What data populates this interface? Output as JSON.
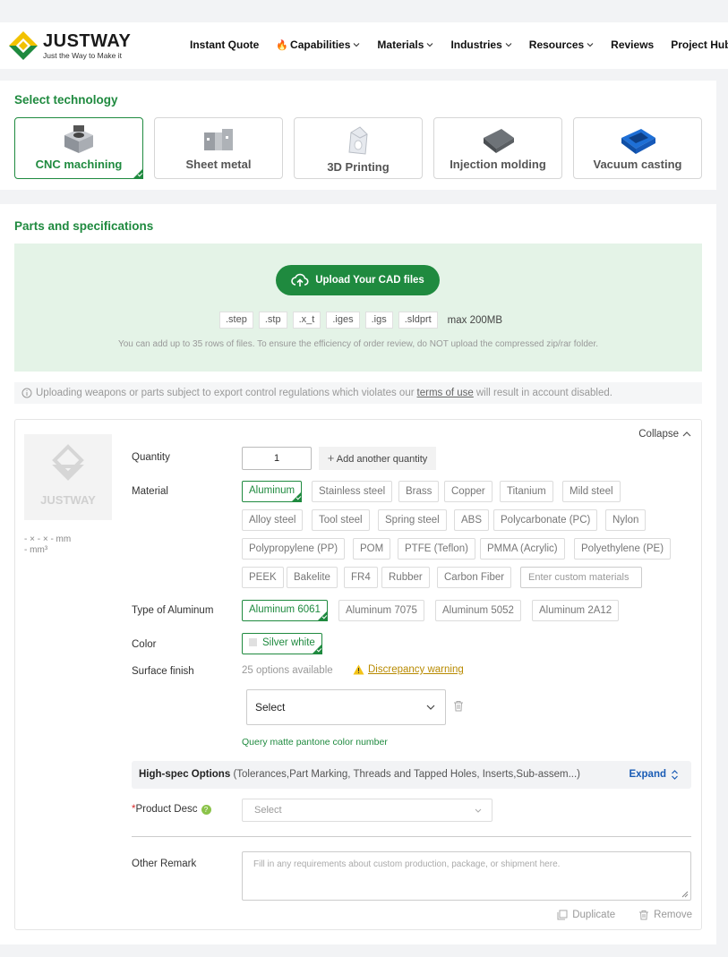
{
  "header": {
    "brand": "JUSTWAY",
    "slogan": "Just the Way to Make it",
    "nav": [
      {
        "label": "Instant Quote",
        "dropdown": false
      },
      {
        "label": "Capabilities",
        "dropdown": true
      },
      {
        "label": "Materials",
        "dropdown": true
      },
      {
        "label": "Industries",
        "dropdown": true
      },
      {
        "label": "Resources",
        "dropdown": true
      },
      {
        "label": "Reviews",
        "dropdown": false
      },
      {
        "label": "Project Hub",
        "dropdown": false
      }
    ]
  },
  "technology": {
    "title": "Select technology",
    "items": [
      {
        "label": "CNC machining",
        "selected": true
      },
      {
        "label": "Sheet metal",
        "selected": false
      },
      {
        "label": "3D Printing",
        "selected": false
      },
      {
        "label": "Injection molding",
        "selected": false
      },
      {
        "label": "Vacuum casting",
        "selected": false
      }
    ]
  },
  "parts": {
    "title": "Parts and specifications",
    "upload_button": "Upload Your CAD files",
    "extensions": [
      ".step",
      ".stp",
      ".x_t",
      ".iges",
      ".igs",
      ".sldprt"
    ],
    "max_size": "max 200MB",
    "note": "You can add up to 35 rows of files. To ensure the efficiency of order review, do NOT upload the compressed zip/rar folder.",
    "warning_prefix": "Uploading weapons or parts subject to export control regulations which violates our",
    "warning_link": "terms of use",
    "warning_suffix": "will result in account disabled."
  },
  "part": {
    "thumb_brand": "JUSTWAY",
    "dims": "- × - × - mm",
    "volume": "- mm³",
    "collapse": "Collapse",
    "quantity_label": "Quantity",
    "quantity_value": "1",
    "add_quantity": "Add another quantity",
    "material_label": "Material",
    "materials": [
      "Aluminum",
      "Stainless steel",
      "Brass",
      "Copper",
      "Titanium",
      "Mild steel",
      "Alloy steel",
      "Tool steel",
      "Spring steel",
      "ABS",
      "Polycarbonate (PC)",
      "Nylon",
      "Polypropylene (PP)",
      "POM",
      "PTFE (Teflon)",
      "PMMA (Acrylic)",
      "Polyethylene (PE)",
      "PEEK",
      "Bakelite",
      "FR4",
      "Rubber",
      "Carbon Fiber"
    ],
    "selected_material": "Aluminum",
    "custom_material_placeholder": "Enter custom materials",
    "type_label": "Type of Aluminum",
    "types": [
      "Aluminum 6061",
      "Aluminum 7075",
      "Aluminum 5052",
      "Aluminum 2A12"
    ],
    "color_label": "Color",
    "color_value": "Silver white",
    "surface_label": "Surface finish",
    "surface_count": "25 options available",
    "discrepancy": "Discrepancy warning",
    "surface_select": "Select",
    "pantone": "Query matte pantone color number",
    "highspec_title": "High-spec Options",
    "highspec_desc": "(Tolerances,Part Marking, Threads and Tapped Holes, Inserts,Sub-assem...)",
    "expand": "Expand",
    "product_desc_label": "Product Desc",
    "product_desc_select": "Select",
    "remark_label": "Other Remark",
    "remark_placeholder": "Fill in any requirements about custom production, package, or shipment here.",
    "duplicate": "Duplicate",
    "remove": "Remove"
  },
  "colors": {
    "accent": "#1f8a3f",
    "link": "#1a5cb5",
    "upload_bg": "#e4f3e7"
  }
}
